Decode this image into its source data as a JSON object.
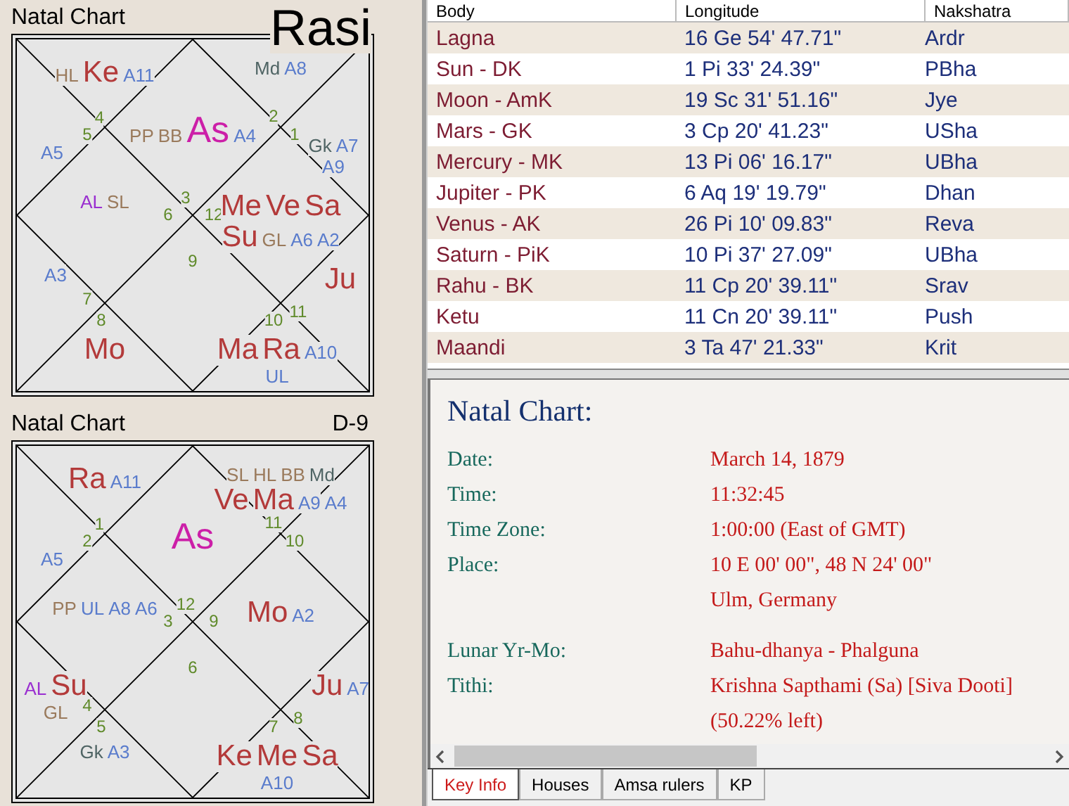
{
  "charts": [
    {
      "title": "Natal Chart",
      "label": "Rasi",
      "houses": [
        {
          "sign": "4",
          "items": [
            {
              "text": "HL",
              "kind": "special"
            },
            {
              "text": "Ke",
              "kind": "planet"
            },
            {
              "text": "A11",
              "kind": "arudha"
            }
          ]
        },
        {
          "sign": "2",
          "items": [
            {
              "text": "Md",
              "kind": "upagraha"
            },
            {
              "text": "A8",
              "kind": "arudha"
            }
          ]
        },
        {
          "sign": "3",
          "items": [
            {
              "text": "PP",
              "kind": "special"
            },
            {
              "text": "BB",
              "kind": "special"
            },
            {
              "text": "As",
              "kind": "lagna"
            },
            {
              "text": "A4",
              "kind": "arudha"
            }
          ]
        },
        {
          "sign": "5",
          "items": [
            {
              "text": "A5",
              "kind": "arudha"
            }
          ]
        },
        {
          "sign": "1",
          "items": [
            {
              "text": "Gk",
              "kind": "upagraha"
            },
            {
              "text": "A7",
              "kind": "arudha"
            },
            {
              "text": "A9",
              "kind": "arudha"
            }
          ]
        },
        {
          "sign": "6",
          "items": [
            {
              "text": "AL",
              "kind": "arudha_lagna"
            },
            {
              "text": "SL",
              "kind": "special"
            }
          ]
        },
        {
          "sign": "12",
          "items": [
            {
              "text": "Me",
              "kind": "planet"
            },
            {
              "text": "Ve",
              "kind": "planet"
            },
            {
              "text": "Sa",
              "kind": "planet"
            },
            {
              "text": "Su",
              "kind": "planet"
            },
            {
              "text": "GL",
              "kind": "special"
            },
            {
              "text": "A6",
              "kind": "arudha"
            },
            {
              "text": "A2",
              "kind": "arudha"
            }
          ]
        },
        {
          "sign": "9"
        },
        {
          "sign": "7",
          "items": [
            {
              "text": "A3",
              "kind": "arudha"
            }
          ]
        },
        {
          "sign": "11",
          "items": [
            {
              "text": "Ju",
              "kind": "planet"
            }
          ]
        },
        {
          "sign": "8",
          "items": [
            {
              "text": "Mo",
              "kind": "planet"
            }
          ]
        },
        {
          "sign": "10",
          "items": [
            {
              "text": "Ma",
              "kind": "planet"
            },
            {
              "text": "Ra",
              "kind": "planet"
            },
            {
              "text": "A10",
              "kind": "arudha"
            },
            {
              "text": "UL",
              "kind": "arudha"
            }
          ]
        }
      ]
    },
    {
      "title": "Natal Chart",
      "label": "D-9",
      "houses": [
        {
          "sign": "1",
          "items": [
            {
              "text": "Ra",
              "kind": "planet"
            },
            {
              "text": "A11",
              "kind": "arudha"
            }
          ]
        },
        {
          "sign": "11",
          "items": [
            {
              "text": "SL",
              "kind": "special"
            },
            {
              "text": "HL",
              "kind": "special"
            },
            {
              "text": "BB",
              "kind": "special"
            },
            {
              "text": "Md",
              "kind": "upagraha"
            },
            {
              "text": "Ve",
              "kind": "planet"
            },
            {
              "text": "Ma",
              "kind": "planet"
            },
            {
              "text": "A9",
              "kind": "arudha"
            },
            {
              "text": "A4",
              "kind": "arudha"
            }
          ]
        },
        {
          "sign": "12",
          "items": [
            {
              "text": "As",
              "kind": "lagna"
            }
          ]
        },
        {
          "sign": "2",
          "items": [
            {
              "text": "A5",
              "kind": "arudha"
            }
          ]
        },
        {
          "sign": "10"
        },
        {
          "sign": "3",
          "items": [
            {
              "text": "PP",
              "kind": "special"
            },
            {
              "text": "UL",
              "kind": "arudha"
            },
            {
              "text": "A8",
              "kind": "arudha"
            },
            {
              "text": "A6",
              "kind": "arudha"
            }
          ]
        },
        {
          "sign": "9",
          "items": [
            {
              "text": "Mo",
              "kind": "planet"
            },
            {
              "text": "A2",
              "kind": "arudha"
            }
          ]
        },
        {
          "sign": "6"
        },
        {
          "sign": "4",
          "items": [
            {
              "text": "AL",
              "kind": "arudha_lagna"
            },
            {
              "text": "Su",
              "kind": "planet"
            },
            {
              "text": "GL",
              "kind": "special"
            }
          ]
        },
        {
          "sign": "8",
          "items": [
            {
              "text": "Ju",
              "kind": "planet"
            },
            {
              "text": "A7",
              "kind": "arudha"
            }
          ]
        },
        {
          "sign": "5",
          "items": [
            {
              "text": "Gk",
              "kind": "upagraha"
            },
            {
              "text": "A3",
              "kind": "arudha"
            }
          ]
        },
        {
          "sign": "7",
          "items": [
            {
              "text": "Ke",
              "kind": "planet"
            },
            {
              "text": "Me",
              "kind": "planet"
            },
            {
              "text": "Sa",
              "kind": "planet"
            },
            {
              "text": "A10",
              "kind": "arudha"
            }
          ]
        }
      ]
    }
  ],
  "table": {
    "columns": [
      "Body",
      "Longitude",
      "Nakshatra"
    ],
    "rows": [
      [
        "Lagna",
        "16 Ge 54' 47.71\"",
        "Ardr"
      ],
      [
        "Sun - DK",
        "1 Pi 33' 24.39\"",
        "PBha"
      ],
      [
        "Moon - AmK",
        "19 Sc 31' 51.16\"",
        "Jye"
      ],
      [
        "Mars - GK",
        "3 Cp 20' 41.23\"",
        "USha"
      ],
      [
        "Mercury - MK",
        "13 Pi 06' 16.17\"",
        "UBha"
      ],
      [
        "Jupiter - PK",
        "6 Aq 19' 19.79\"",
        "Dhan"
      ],
      [
        "Venus - AK",
        "26 Pi 10' 09.83\"",
        "Reva"
      ],
      [
        "Saturn - PiK",
        "10 Pi 37' 27.09\"",
        "UBha"
      ],
      [
        "Rahu - BK",
        "11 Cp 20' 39.11\"",
        "Srav"
      ],
      [
        "Ketu",
        "11 Cn 20' 39.11\"",
        "Push"
      ],
      [
        "Maandi",
        "3 Ta 47' 21.33\"",
        "Krit"
      ]
    ]
  },
  "key_info": {
    "title": "Natal Chart:",
    "sections": [
      [
        {
          "label": "Date:",
          "lines": [
            "March 14, 1879"
          ]
        },
        {
          "label": "Time:",
          "lines": [
            "11:32:45"
          ]
        },
        {
          "label": "Time Zone:",
          "lines": [
            "1:00:00 (East of GMT)"
          ]
        },
        {
          "label": "Place:",
          "lines": [
            "10 E 00' 00\", 48 N 24' 00\"",
            "Ulm, Germany"
          ]
        }
      ],
      [
        {
          "label": "Lunar Yr-Mo:",
          "lines": [
            "Bahu-dhanya - Phalguna"
          ]
        },
        {
          "label": "Tithi:",
          "lines": [
            "Krishna Sapthami (Sa) [Siva Dooti]",
            "(50.22% left)"
          ]
        }
      ]
    ]
  },
  "tabs": [
    {
      "label": "Key Info",
      "selected": true
    },
    {
      "label": "Houses",
      "selected": false
    },
    {
      "label": "Amsa rulers",
      "selected": false
    },
    {
      "label": "KP",
      "selected": false
    }
  ]
}
